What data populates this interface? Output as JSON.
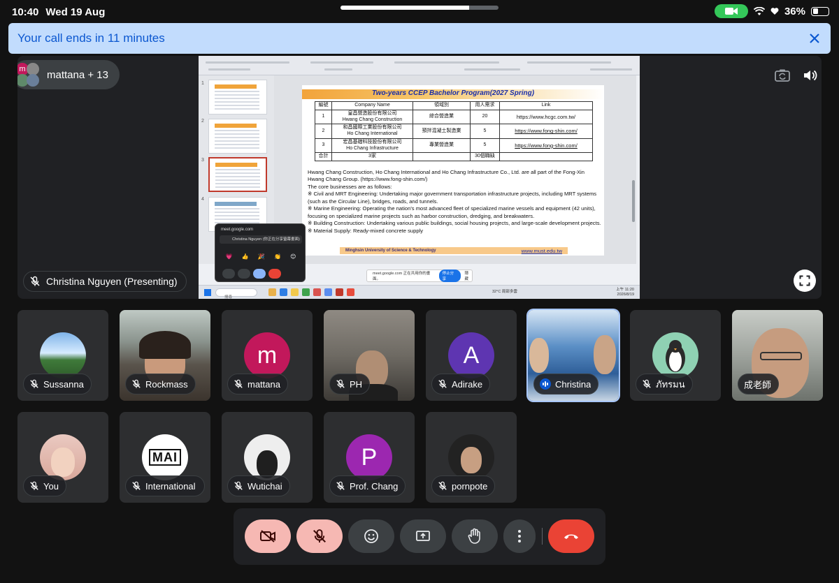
{
  "status_bar": {
    "time": "10:40",
    "date": "Wed 19 Aug",
    "battery_percent": "36%",
    "battery_level": 0.36,
    "camera_active_color": "#34c759"
  },
  "banner": {
    "text": "Your call ends in 11 minutes",
    "close_icon": "close-icon"
  },
  "stage": {
    "participants_label": "mattana + 13",
    "presenter_label": "Christina Nguyen (Presenting)",
    "screen": {
      "slide_title": "Two-years CCEP Bachelor Program(2027 Spring)",
      "table_headers": [
        "編號",
        "Company Name",
        "領域別",
        "用人需求",
        "Link"
      ],
      "table_rows": [
        {
          "no": "1",
          "company_zh": "皇昌營造股份有限公司",
          "company_en": "Hwang Chang Construction",
          "field": "綜合營造業",
          "demand": "20",
          "link": "https://www.hcgc.com.tw/"
        },
        {
          "no": "2",
          "company_zh": "和昌國際工業股份有限公司",
          "company_en": "Ho Chang International",
          "field": "預拌混凝土製造業",
          "demand": "5",
          "link": "https://www.fong-shin.com/"
        },
        {
          "no": "3",
          "company_zh": "宏昌基礎科技股份有限公司",
          "company_en": "Ho Chang Infrastructure",
          "field": "專業營造業",
          "demand": "5",
          "link": "https://www.fong-shin.com/"
        }
      ],
      "table_total": {
        "label": "合計",
        "companies": "3家",
        "demand": "30個職缺"
      },
      "paragraph": [
        "Hwang Chang Construction, Ho Chang International and Ho Chang Infrastructure Co., Ltd. are all part of the Fong-Xin Hwang Chang Group. (https://www.fong-shin.com/)",
        "The core businesses are as follows:",
        "※ Civil and MRT Engineering: Undertaking major government transportation infrastructure projects, including MRT systems (such as the Circular Line), bridges, roads, and tunnels.",
        "※ Marine Engineering: Operating the nation's most advanced fleet of specialized marine vessels and equipment (42 units), focusing on specialized marine projects such as harbor construction, dredging, and breakwaters.",
        "※ Building Construction: Undertaking various public buildings, social housing projects, and large-scale development projects.",
        "※ Material Supply: Ready-mixed concrete supply"
      ],
      "footer_school": "Minghsin University of Science & Technology",
      "footer_web": "www.must.edu.tw",
      "thumb_numbers": [
        "1",
        "2",
        "3",
        "4"
      ],
      "mini_window": {
        "url": "meet.google.com",
        "row": "Christina Nguyen (你正在分享螢幕畫面)"
      },
      "share_bar": {
        "text": "meet.google.com 正在共用你的畫面。",
        "stop": "停止分享",
        "hide": "隱藏"
      },
      "taskbar": {
        "search": "搜尋",
        "weather": "32°C 局部多雲",
        "clock_time": "上午 11:20",
        "clock_date": "2026/8/19"
      }
    }
  },
  "tiles": [
    {
      "name": "Sussanna",
      "muted": true,
      "avatar": "photo",
      "color": "#5b8fbf"
    },
    {
      "name": "Rockmass",
      "muted": true,
      "avatar": "video",
      "color": "#6d6258"
    },
    {
      "name": "mattana",
      "muted": true,
      "avatar": "letter",
      "letter": "m",
      "color": "#c2185b"
    },
    {
      "name": "PH",
      "muted": true,
      "avatar": "video",
      "color": "#55504a"
    },
    {
      "name": "Adirake",
      "muted": true,
      "avatar": "letter",
      "letter": "A",
      "color": "#5e35b1"
    },
    {
      "name": "Christina",
      "muted": false,
      "speaking": true,
      "avatar": "video",
      "color": "#3f6fa8"
    },
    {
      "name": "ภัทรมน",
      "muted": true,
      "avatar": "photo",
      "color": "#7bc8a4"
    },
    {
      "name": "成老師",
      "muted": false,
      "avatar": "video",
      "color": "#8a8f8c"
    },
    {
      "name": "You",
      "muted": true,
      "avatar": "photo",
      "color": "#b98a86"
    },
    {
      "name": "International Talent",
      "muted": true,
      "avatar": "photo",
      "color": "#ffffff"
    },
    {
      "name": "Wutichai",
      "muted": true,
      "avatar": "photo",
      "color": "#e9e9e9"
    },
    {
      "name": "Prof. Chang",
      "muted": true,
      "avatar": "letter",
      "letter": "P",
      "color": "#9c27b0"
    },
    {
      "name": "pornpote",
      "muted": true,
      "avatar": "photo",
      "color": "#2b2b2b"
    }
  ],
  "controls": {
    "camera_off": "video-off-icon",
    "mic_off": "mic-off-icon",
    "reactions": "emoji-icon",
    "present": "present-screen-icon",
    "raise_hand": "hand-icon",
    "more": "more-vert-icon",
    "hang_up": "call-end-icon",
    "danger_color": "#f6b8b3",
    "hangup_color": "#ea4335"
  }
}
